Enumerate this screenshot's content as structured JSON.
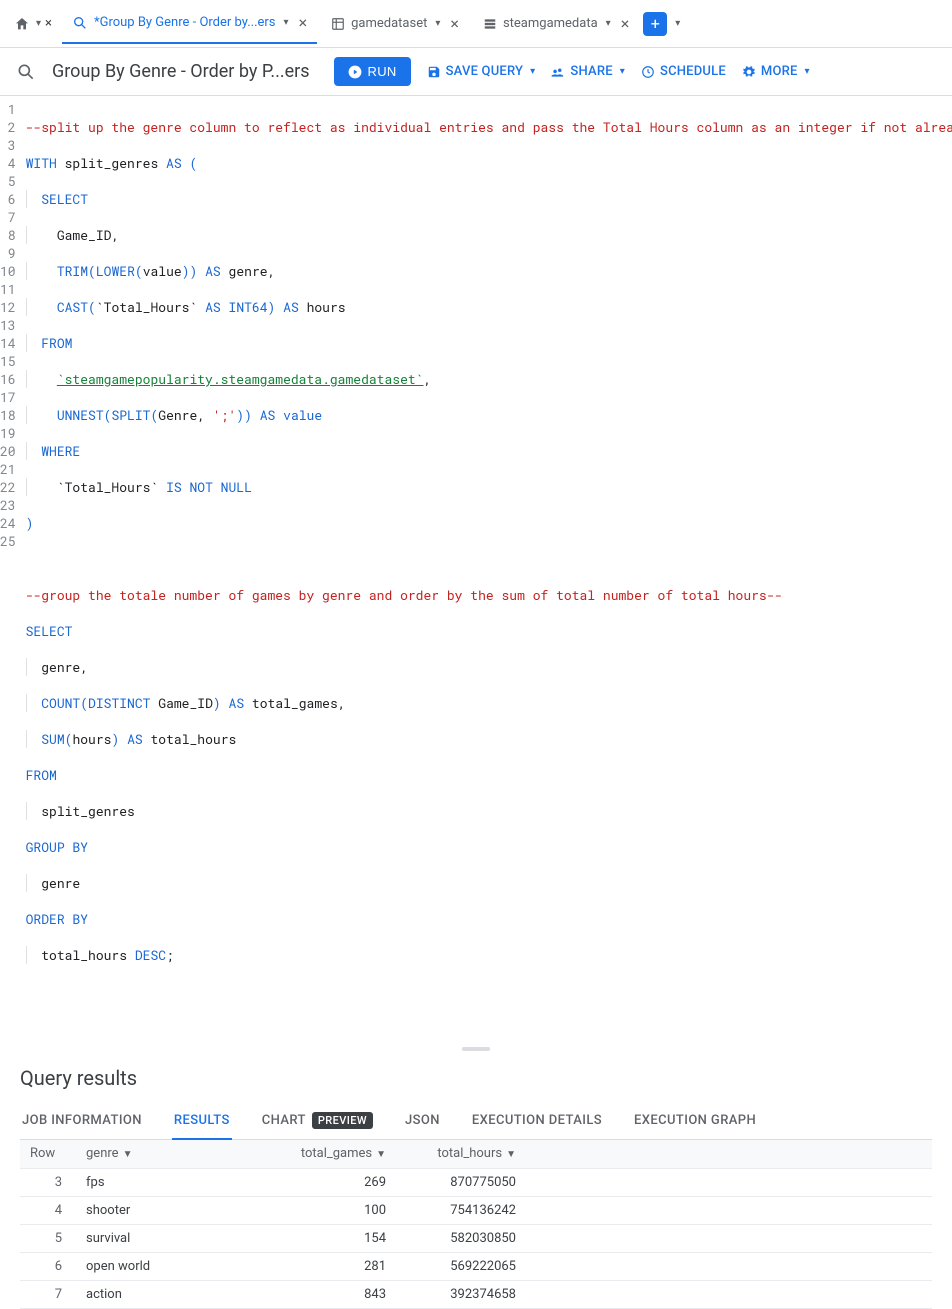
{
  "tabs": {
    "active": {
      "label": "*Group By Genre - Order by...ers"
    },
    "t1": {
      "label": "gamedataset"
    },
    "t2": {
      "label": "steamgamedata"
    }
  },
  "toolbar": {
    "title": "Group By Genre - Order by P...ers",
    "run": "RUN",
    "save": "SAVE QUERY",
    "share": "SHARE",
    "schedule": "SCHEDULE",
    "more": "MORE"
  },
  "code": {
    "l1": "--split up the genre column to reflect as individual entries and pass the Total Hours column as an integer if not already--",
    "l2a": "WITH",
    "l2b": " split_genres ",
    "l2c": "AS",
    "l2d": " (",
    "l3": "SELECT",
    "l4": "Game_ID,",
    "l5a": "TRIM",
    "l5b": "LOWER",
    "l5c": "value",
    "l5d": "AS",
    "l5e": " genre,",
    "l6a": "CAST",
    "l6b": "`Total_Hours`",
    "l6c": "AS",
    "l6d": "INT64",
    "l6e": "AS",
    "l6f": " hours",
    "l7": "FROM",
    "l8": "`steamgamepopularity.steamgamedata.gamedataset`",
    "l9a": "UNNEST",
    "l9b": "SPLIT",
    "l9c": "Genre, ",
    "l9d": "';'",
    "l9e": "AS",
    "l9f": "value",
    "l10": "WHERE",
    "l11a": "`Total_Hours`",
    "l11b": "IS NOT NULL",
    "l12": ")",
    "l14": "--group the totale number of games by genre and order by the sum of total number of total hours--",
    "l15": "SELECT",
    "l16": "genre,",
    "l17a": "COUNT",
    "l17b": "DISTINCT",
    "l17c": " Game_ID",
    "l17d": "AS",
    "l17e": " total_games,",
    "l18a": "SUM",
    "l18b": "hours",
    "l18c": "AS",
    "l18d": " total_hours",
    "l19": "FROM",
    "l20": "split_genres",
    "l21": "GROUP BY",
    "l22": "genre",
    "l23": "ORDER BY",
    "l24a": "total_hours ",
    "l24b": "DESC",
    "l24c": ";"
  },
  "results": {
    "title": "Query results",
    "tabs": {
      "job": "JOB INFORMATION",
      "results": "RESULTS",
      "chart": "CHART",
      "preview": "PREVIEW",
      "json": "JSON",
      "exec": "EXECUTION DETAILS",
      "graph": "EXECUTION GRAPH"
    },
    "columns": {
      "row": "Row",
      "genre": "genre",
      "games": "total_games",
      "hours": "total_hours"
    },
    "rows": [
      {
        "n": "3",
        "genre": "fps",
        "games": "269",
        "hours": "870775050"
      },
      {
        "n": "4",
        "genre": "shooter",
        "games": "100",
        "hours": "754136242"
      },
      {
        "n": "5",
        "genre": "survival",
        "games": "154",
        "hours": "582030850"
      },
      {
        "n": "6",
        "genre": "open world",
        "games": "281",
        "hours": "569222065"
      },
      {
        "n": "7",
        "genre": "action",
        "games": "843",
        "hours": "392374658"
      }
    ]
  }
}
